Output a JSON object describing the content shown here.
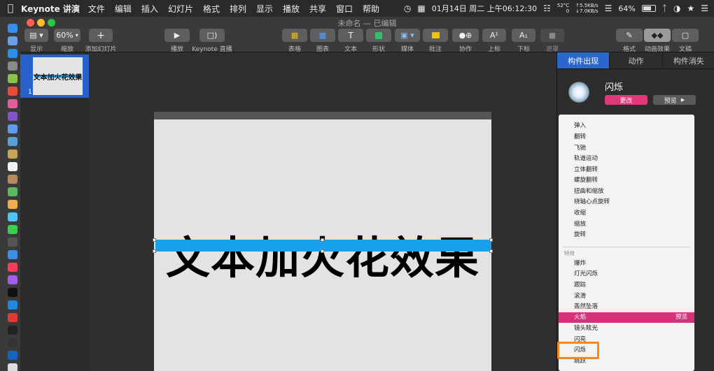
{
  "menubar": {
    "apple": "",
    "app_name": "Keynote 讲演",
    "items": [
      "文件",
      "编辑",
      "插入",
      "幻灯片",
      "格式",
      "排列",
      "显示",
      "播放",
      "共享",
      "窗口",
      "帮助"
    ],
    "datetime": "01月14日 周二 上午06:12:30",
    "cpu_temp": "52°C",
    "cpu_label": "0",
    "net_up": "↑5.5KB/s",
    "net_down": "↓7.0KB/s",
    "battery": "64%"
  },
  "window": {
    "title": "未命名 — 已编辑"
  },
  "toolbar": {
    "view_label": "显示",
    "zoom_value": "60%",
    "zoom_label": "缩放",
    "add_slide_label": "添加幻灯片",
    "play_label": "播放",
    "live_label": "Keynote 直播",
    "table_label": "表格",
    "chart_label": "图表",
    "text_label": "文本",
    "shape_label": "形状",
    "media_label": "媒体",
    "comment_label": "批注",
    "collab_label": "协作",
    "superscript_label": "上标",
    "subscript_label": "下标",
    "mask_label": "遮罩",
    "format_label": "格式",
    "animate_label": "动画效果",
    "document_label": "文稿"
  },
  "navigator": {
    "slide_number": "1",
    "thumb_text": "文本加火花效果"
  },
  "slide": {
    "text": "文本加火花效果"
  },
  "inspector": {
    "tabs": [
      "构件出现",
      "动作",
      "构件消失"
    ],
    "effect_name": "闪烁",
    "change_button": "更改",
    "preview_button": "预览"
  },
  "dropdown": {
    "basic_items": [
      "弹入",
      "翻转",
      "飞驰",
      "轨道运动",
      "立体翻转",
      "螺旋翻转",
      "扭曲和缩放",
      "绕轴心点旋转",
      "收缩",
      "缩放",
      "旋转"
    ],
    "section_label": "特效",
    "effect_items": [
      "爆炸",
      "灯光闪烁",
      "跟踪",
      "滚滑",
      "轰然坠落",
      "火焰",
      "镜头眩光",
      "闪亮",
      "闪烁",
      "跳跃"
    ],
    "highlighted_item": "火焰",
    "highlight_preview": "预览",
    "boxed_item": "闪烁"
  },
  "colors": {
    "accent_blue": "#2b66cc",
    "highlight_pink": "#d6327a",
    "slide_bar_blue": "#18a2ee",
    "annotation_orange": "#f5891f"
  }
}
